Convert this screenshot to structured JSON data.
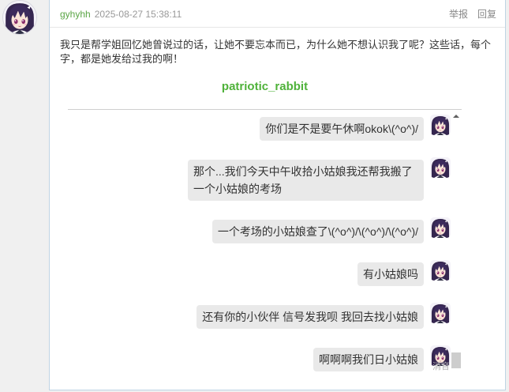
{
  "post": {
    "avatar_icon": "anime-girl-avatar",
    "author": "gyhyhh",
    "timestamp": "2025-08-27 15:38:11",
    "actions": {
      "report": "举报",
      "reply": "回复"
    },
    "body": "我只是帮学姐回忆她曾说过的话，让她不要忘本而已，为什么她不想认识我了呢？这些话，每个字，都是她发给过我的啊！",
    "quoted_name": "patriotic_rabbit"
  },
  "chat": {
    "avatar_icon": "anime-girl-avatar",
    "messages": [
      {
        "text": "你们是不是要午休啊okok\\(^o^)/"
      },
      {
        "text": "那个...我们今天中午收拾小姑娘我还帮我搬了一个小姑娘的考场"
      },
      {
        "text": "一个考场的小姑娘查了\\(^o^)/\\(^o^)/\\(^o^)/"
      },
      {
        "text": "有小姑娘吗"
      },
      {
        "text": "还有你的小伙伴 信号发我呗 我回去找小姑娘"
      },
      {
        "text": "啊啊啊我们日小姑娘"
      }
    ],
    "overlay_label": "消音",
    "scroll_up_icon": "scroll-up-arrow-icon"
  },
  "colors": {
    "username": "#5aa545",
    "quoted_name": "#4fb23a",
    "meta_text": "#999999",
    "action_text": "#888888",
    "body_text": "#333333",
    "bubble": "#e9e9e9",
    "card_border": "#bfd4e4",
    "page_bg": "#f0f0f0"
  }
}
